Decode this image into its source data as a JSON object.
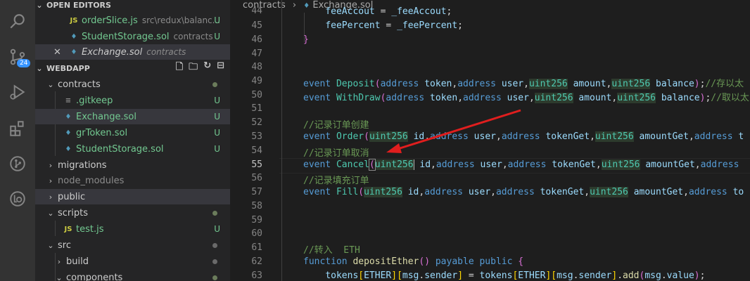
{
  "activity_bar": {
    "scm_badge": "24"
  },
  "open_editors": {
    "title": "OPEN EDITORS",
    "items": [
      {
        "name": "orderSlice.js",
        "path": "src\\redux\\balanc...",
        "status": "U"
      },
      {
        "name": "StudentStorage.sol",
        "path": "contracts",
        "status": "U"
      },
      {
        "name": "Exchange.sol",
        "path": "contracts",
        "status": ""
      }
    ]
  },
  "explorer": {
    "title": "WEBDAPP",
    "tree": [
      {
        "label": "contracts"
      },
      {
        "label": ".gitkeep",
        "status": "U"
      },
      {
        "label": "Exchange.sol",
        "status": "U"
      },
      {
        "label": "grToken.sol",
        "status": "U"
      },
      {
        "label": "StudentStorage.sol",
        "status": "U"
      },
      {
        "label": "migrations"
      },
      {
        "label": "node_modules"
      },
      {
        "label": "public"
      },
      {
        "label": "scripts"
      },
      {
        "label": "test.js",
        "status": "U"
      },
      {
        "label": "src"
      },
      {
        "label": "build"
      },
      {
        "label": "components"
      }
    ]
  },
  "breadcrumb": {
    "folder": "contracts",
    "sep": "›",
    "file": "Exchange.sol"
  },
  "editor": {
    "line_numbers": [
      "44",
      "45",
      "46",
      "47",
      "48",
      "49",
      "50",
      "51",
      "52",
      "53",
      "54",
      "55",
      "56",
      "57",
      "58",
      "59",
      "60",
      "61",
      "62",
      "63"
    ],
    "current_line": "55"
  }
}
